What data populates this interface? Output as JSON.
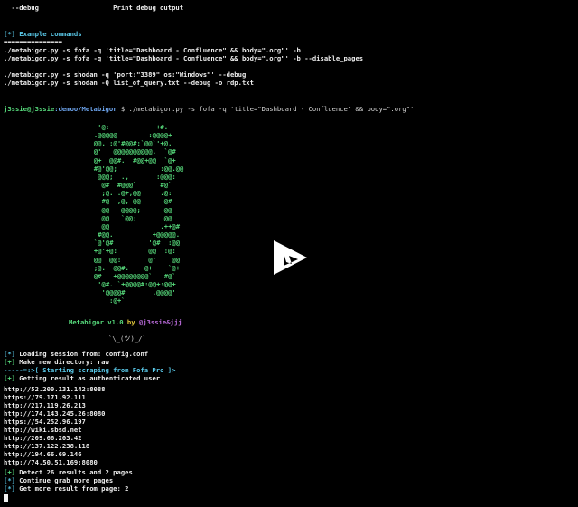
{
  "help_line": {
    "flag": "  --debug",
    "description": "Print debug output"
  },
  "example": {
    "marker": "[*]",
    "title": " Example commands",
    "underline": "===============",
    "commands": [
      "./metabigor.py -s fofa -q 'title=\"Dashboard - Confluence\" && body=\".org\"' -b",
      "./metabigor.py -s fofa -q 'title=\"Dashboard - Confluence\" && body=\".org\"' -b --disable_pages",
      "./metabigor.py -s shodan -q 'port:\"3389\" os:\"Windows\"' --debug",
      "./metabigor.py -s shodan -Q list_of_query.txt --debug -o rdp.txt"
    ]
  },
  "prompt": {
    "user_host": "j3ssie@j3ssie",
    "path": ":demoo/Metabigor",
    "symbol": " $ ",
    "command": "./metabigor.py -s fofa -q 'title=\"Dashboard - Confluence\" && body=\".org\"'"
  },
  "logo_art": [
    "                         '@:            +#.",
    "                        .@@@@@        :@@@@+",
    "                        @@. :@'#@@#;`@@`'+@.",
    "                        @'   @@@@@@@@@@.  `@#",
    "                        @+  @@#.  #@@+@@  `@+",
    "                        #@'@@;           :@@.@@",
    "                         @@@;  .,       :@@@:",
    "                          @#  #@@@`      #@`",
    "                          ;@. .@+,@@     .@:",
    "                          #@  ,@, @@      @#",
    "                          @@   @@@@;      @@",
    "                          @@   `@@;       @@",
    "                          @@             .++@#",
    "                         #@@.          +@@@@@.",
    "                        `@'@#         '@#  :@@",
    "                        +@'+@:        @@  :@:",
    "                        @@  @@:       @'    @@",
    "                        ;@.  @@#.    @+    `@+",
    "                        @#   +@@@@@@@@`   #@`",
    "                         '@#. `+@@@@#:@@+:@@+",
    "                          '@@@@#       .@@@@'",
    "                            :@+`"
  ],
  "banner": {
    "name": "Metabigor",
    "version": " v1.0",
    "by": " by ",
    "author": "@j3ssie&jjj",
    "face": "`\\_(ツ)_/`"
  },
  "output": {
    "loading": {
      "marker": "[*]",
      "text": " Loading session from: config.conf"
    },
    "mkdir": {
      "marker": "[+]",
      "text": " Make new directory: raw"
    },
    "scraping": "-----=:>[ Starting scraping from Fofa Pro ]>",
    "auth": {
      "marker": "[+]",
      "text": " Getting result as authenticated user"
    },
    "results": [
      "http://52.200.131.142:8088",
      "https://79.171.92.111",
      "http://217.119.26.213",
      "http://174.143.245.26:8080",
      "https://54.252.96.197",
      "http://wiki.sbsd.net",
      "http://209.66.203.42",
      "http://137.122.238.118",
      "http://194.66.69.146",
      "http://74.50.51.169:8080"
    ],
    "detect": {
      "marker": "[+]",
      "text": " Detect 26 results and 2 pages"
    },
    "continue": {
      "marker": "[*]",
      "text": " Continue grab more pages"
    },
    "more": {
      "marker": "[*]",
      "text": " Get more result from page: 2"
    }
  },
  "colors": {
    "background": "#000000",
    "cyan": "#59c8e8",
    "green": "#56d97b",
    "play_button": "#ffffff"
  },
  "overlay_icon": "play-button-icon"
}
